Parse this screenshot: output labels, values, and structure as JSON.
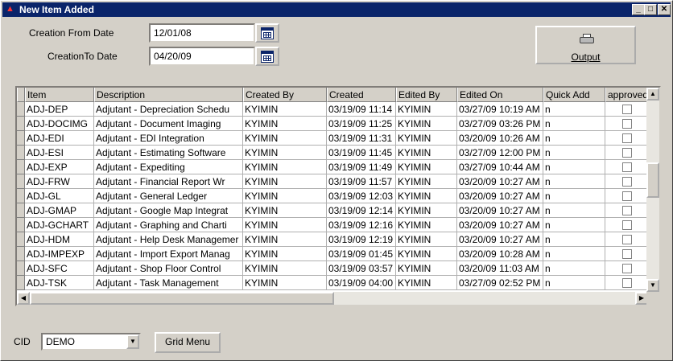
{
  "window": {
    "title": "New Item Added",
    "min": "_",
    "max": "□",
    "close": "✕",
    "app_icon": "▲"
  },
  "filters": {
    "from_label": "Creation From Date",
    "from_value": "12/01/08",
    "to_label": "CreationTo Date",
    "to_value": "04/20/09"
  },
  "output": {
    "label": "Output"
  },
  "grid": {
    "columns": [
      "Item",
      "Description",
      "Created By",
      "Created",
      "Edited By",
      "Edited On",
      "Quick Add",
      "approved"
    ],
    "rows": [
      [
        "ADJ-DEP",
        "Adjutant - Depreciation Schedu",
        "KYIMIN",
        "03/19/09 11:14",
        "KYIMIN",
        "03/27/09 10:19 AM",
        "n"
      ],
      [
        "ADJ-DOCIMG",
        "Adjutant - Document Imaging",
        "KYIMIN",
        "03/19/09 11:25",
        "KYIMIN",
        "03/27/09 03:26 PM",
        "n"
      ],
      [
        "ADJ-EDI",
        "Adjutant - EDI Integration",
        "KYIMIN",
        "03/19/09 11:31",
        "KYIMIN",
        "03/20/09 10:26 AM",
        "n"
      ],
      [
        "ADJ-ESI",
        "Adjutant - Estimating Software",
        "KYIMIN",
        "03/19/09 11:45",
        "KYIMIN",
        "03/27/09 12:00 PM",
        "n"
      ],
      [
        "ADJ-EXP",
        "Adjutant - Expediting",
        "KYIMIN",
        "03/19/09 11:49",
        "KYIMIN",
        "03/27/09 10:44 AM",
        "n"
      ],
      [
        "ADJ-FRW",
        "Adjutant - Financial Report Wr",
        "KYIMIN",
        "03/19/09 11:57",
        "KYIMIN",
        "03/20/09 10:27 AM",
        "n"
      ],
      [
        "ADJ-GL",
        "Adjutant - General Ledger",
        "KYIMIN",
        "03/19/09 12:03",
        "KYIMIN",
        "03/20/09 10:27 AM",
        "n"
      ],
      [
        "ADJ-GMAP",
        "Adjutant - Google Map Integrat",
        "KYIMIN",
        "03/19/09 12:14",
        "KYIMIN",
        "03/20/09 10:27 AM",
        "n"
      ],
      [
        "ADJ-GCHART",
        "Adjutant - Graphing and Charti",
        "KYIMIN",
        "03/19/09 12:16",
        "KYIMIN",
        "03/20/09 10:27 AM",
        "n"
      ],
      [
        "ADJ-HDM",
        "Adjutant - Help Desk Managemer",
        "KYIMIN",
        "03/19/09 12:19",
        "KYIMIN",
        "03/20/09 10:27 AM",
        "n"
      ],
      [
        "ADJ-IMPEXP",
        "Adjutant - Import Export Manag",
        "KYIMIN",
        "03/19/09 01:45",
        "KYIMIN",
        "03/20/09 10:28 AM",
        "n"
      ],
      [
        "ADJ-SFC",
        "Adjutant - Shop Floor Control",
        "KYIMIN",
        "03/19/09 03:57",
        "KYIMIN",
        "03/20/09 11:03 AM",
        "n"
      ],
      [
        "ADJ-TSK",
        "Adjutant - Task Management",
        "KYIMIN",
        "03/19/09 04:00",
        "KYIMIN",
        "03/27/09 02:52 PM",
        "n"
      ]
    ]
  },
  "cid": {
    "label": "CID",
    "value": "DEMO"
  },
  "grid_menu": {
    "label": "Grid Menu"
  },
  "scroll_arrows": {
    "up": "▲",
    "down": "▼",
    "left": "◀",
    "right": "▶",
    "combo": "▼"
  }
}
